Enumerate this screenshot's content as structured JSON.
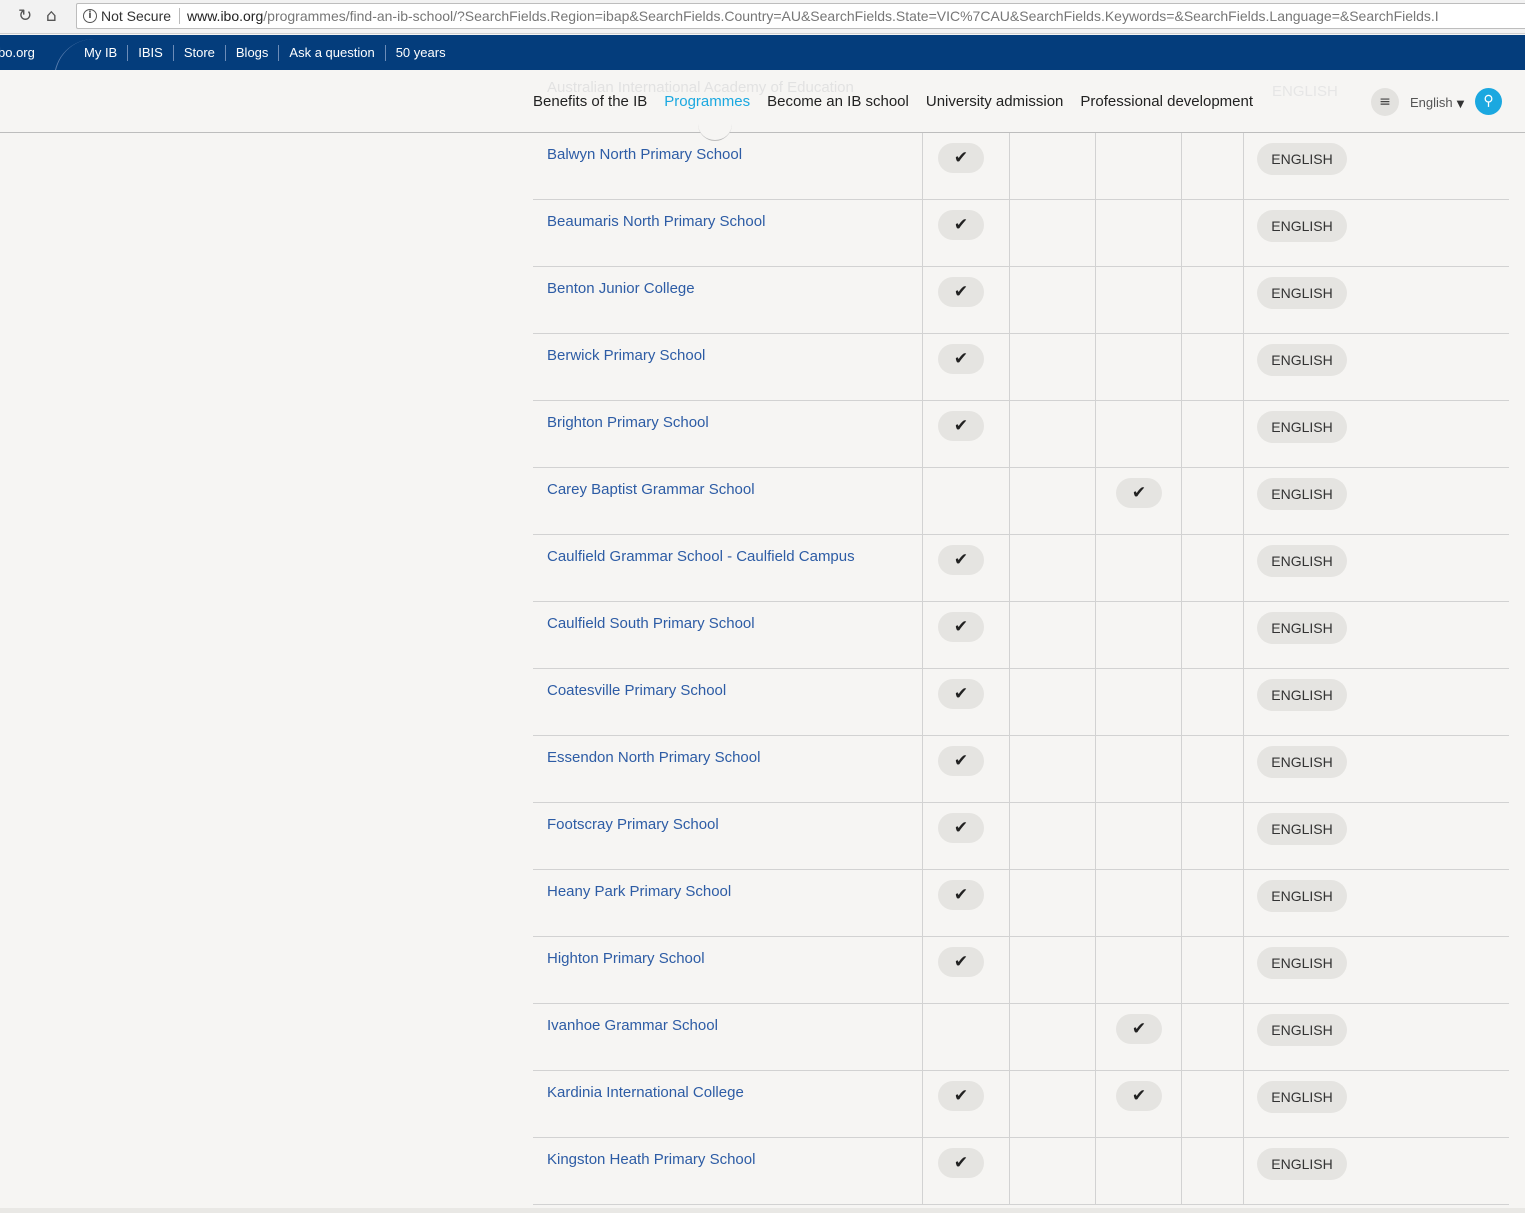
{
  "browser": {
    "not_secure": "Not Secure",
    "url_host": "www.ibo.org",
    "url_path": "/programmes/find-an-ib-school/?SearchFields.Region=ibap&SearchFields.Country=AU&SearchFields.State=VIC%7CAU&SearchFields.Keywords=&SearchFields.Language=&SearchFields.I"
  },
  "utility_bar": {
    "site": "bo.org",
    "links": [
      "My IB",
      "IBIS",
      "Store",
      "Blogs",
      "Ask a question",
      "50 years"
    ]
  },
  "header": {
    "ghost_row_text": "Australian International Academy of Education",
    "ghost_row_language": "ENGLISH",
    "nav": [
      "Benefits of the IB",
      "Programmes",
      "Become an IB school",
      "University admission",
      "Professional development"
    ],
    "active_nav": "Programmes",
    "language": "English",
    "icons": {
      "menu": "menu-icon",
      "search": "search-icon",
      "dropdown": "caret-down-icon"
    }
  },
  "colors": {
    "utility_bar": "#043d7c",
    "accent": "#1ba8e0",
    "link": "#2d5ca5"
  },
  "check_symbol": "✔",
  "schools": [
    {
      "name": "Balwyn North Primary School",
      "pyp": true,
      "dp": false,
      "language": "ENGLISH"
    },
    {
      "name": "Beaumaris North Primary School",
      "pyp": true,
      "dp": false,
      "language": "ENGLISH"
    },
    {
      "name": "Benton Junior College",
      "pyp": true,
      "dp": false,
      "language": "ENGLISH"
    },
    {
      "name": "Berwick Primary School",
      "pyp": true,
      "dp": false,
      "language": "ENGLISH"
    },
    {
      "name": "Brighton Primary School",
      "pyp": true,
      "dp": false,
      "language": "ENGLISH"
    },
    {
      "name": "Carey Baptist Grammar School",
      "pyp": false,
      "dp": true,
      "language": "ENGLISH"
    },
    {
      "name": "Caulfield Grammar School - Caulfield Campus",
      "pyp": true,
      "dp": false,
      "language": "ENGLISH"
    },
    {
      "name": "Caulfield South Primary School",
      "pyp": true,
      "dp": false,
      "language": "ENGLISH"
    },
    {
      "name": "Coatesville Primary School",
      "pyp": true,
      "dp": false,
      "language": "ENGLISH"
    },
    {
      "name": "Essendon North Primary School",
      "pyp": true,
      "dp": false,
      "language": "ENGLISH"
    },
    {
      "name": "Footscray Primary School",
      "pyp": true,
      "dp": false,
      "language": "ENGLISH"
    },
    {
      "name": "Heany Park Primary School",
      "pyp": true,
      "dp": false,
      "language": "ENGLISH"
    },
    {
      "name": "Highton Primary School",
      "pyp": true,
      "dp": false,
      "language": "ENGLISH"
    },
    {
      "name": "Ivanhoe Grammar School",
      "pyp": false,
      "dp": true,
      "language": "ENGLISH"
    },
    {
      "name": "Kardinia International College",
      "pyp": true,
      "dp": true,
      "language": "ENGLISH"
    },
    {
      "name": "Kingston Heath Primary School",
      "pyp": true,
      "dp": false,
      "language": "ENGLISH"
    }
  ]
}
